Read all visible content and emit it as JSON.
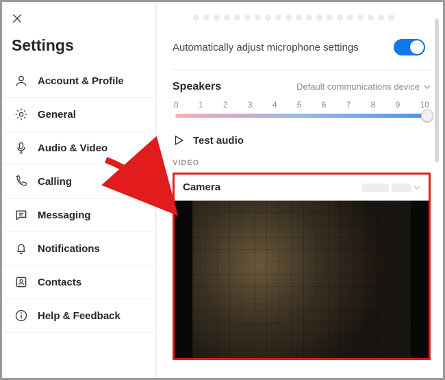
{
  "title": "Settings",
  "sidebar": {
    "items": [
      {
        "icon": "person-icon",
        "label": "Account & Profile"
      },
      {
        "icon": "gear-icon",
        "label": "General"
      },
      {
        "icon": "mic-icon",
        "label": "Audio & Video"
      },
      {
        "icon": "phone-icon",
        "label": "Calling"
      },
      {
        "icon": "chat-icon",
        "label": "Messaging"
      },
      {
        "icon": "bell-icon",
        "label": "Notifications"
      },
      {
        "icon": "contacts-icon",
        "label": "Contacts"
      },
      {
        "icon": "info-icon",
        "label": "Help & Feedback"
      }
    ]
  },
  "audio": {
    "auto_adjust_label": "Automatically adjust microphone settings",
    "auto_adjust_on": true,
    "speakers_label": "Speakers",
    "speakers_device": "Default communications device",
    "slider_ticks": [
      "0",
      "1",
      "2",
      "3",
      "4",
      "5",
      "6",
      "7",
      "8",
      "9",
      "10"
    ],
    "slider_value": 10,
    "test_label": "Test audio"
  },
  "video": {
    "section_label": "VIDEO",
    "camera_label": "Camera"
  },
  "colors": {
    "accent": "#0f7beb",
    "highlight_box": "#e21c1c",
    "arrow": "#e21c1c"
  }
}
